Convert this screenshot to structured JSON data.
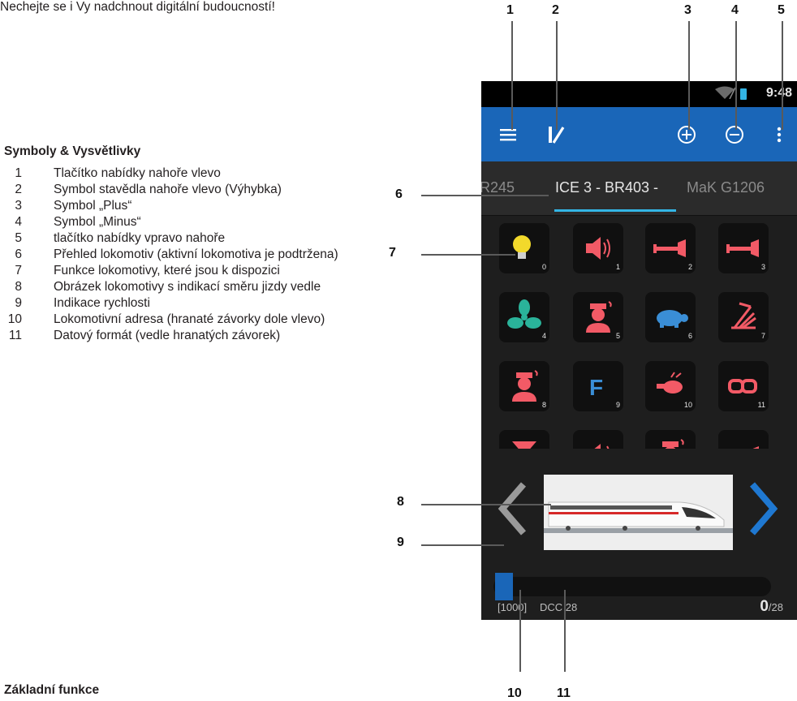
{
  "intro_text": "Nechejte se i Vy nadchnout digitální budoucností!",
  "legend": {
    "heading": "Symboly & Vysvětlivky",
    "items": [
      {
        "num": "1",
        "text": "Tlačítko nabídky nahoře vlevo"
      },
      {
        "num": "2",
        "text": "Symbol stavědla nahoře vlevo (Výhybka)"
      },
      {
        "num": "3",
        "text": "Symbol „Plus“"
      },
      {
        "num": "4",
        "text": "Symbol „Minus“"
      },
      {
        "num": "5",
        "text": "tlačítko nabídky vpravo nahoře"
      },
      {
        "num": "6",
        "text": "Přehled lokomotiv (aktivní lokomotiva je podtržena)"
      },
      {
        "num": "7",
        "text": "Funkce lokomotivy, které jsou k dispozici"
      },
      {
        "num": "8",
        "text": "Obrázek lokomotivy s indikací směru jizdy vedle"
      },
      {
        "num": "9",
        "text": "Indikace rychlosti"
      },
      {
        "num": "10",
        "text": "Lokomotivní adresa (hranaté závorky dole vlevo)"
      },
      {
        "num": "11",
        "text": "Datový formát (vedle hranatých závorek)"
      }
    ]
  },
  "section_heading": "Základní funkce",
  "callouts": [
    "1",
    "2",
    "3",
    "4",
    "5",
    "6",
    "7",
    "8",
    "9",
    "10",
    "11"
  ],
  "phone": {
    "status_time": "9:48",
    "icons": {
      "menu": "menu-icon",
      "switch": "turnout-icon",
      "plus": "plus-circle-icon",
      "minus": "minus-circle-icon",
      "overflow": "overflow-menu-icon"
    },
    "tabs": [
      {
        "label": "R245",
        "active": false
      },
      {
        "label": "ICE 3 - BR403 -",
        "active": true
      },
      {
        "label": "MaK G1206",
        "active": false
      }
    ],
    "functions": [
      {
        "num": "0",
        "icon": "bulb-icon",
        "color": "#f2d92b"
      },
      {
        "num": "1",
        "icon": "speaker-icon",
        "color": "#f25a66"
      },
      {
        "num": "2",
        "icon": "horn-icon",
        "color": "#f25a66"
      },
      {
        "num": "3",
        "icon": "horn-icon",
        "color": "#f25a66"
      },
      {
        "num": "4",
        "icon": "fan-icon",
        "color": "#2ab39a"
      },
      {
        "num": "5",
        "icon": "conductor-icon",
        "color": "#f25a66"
      },
      {
        "num": "6",
        "icon": "turtle-icon",
        "color": "#3a8ed6"
      },
      {
        "num": "7",
        "icon": "pantograph-icon",
        "color": "#f25a66"
      },
      {
        "num": "8",
        "icon": "conductor-icon",
        "color": "#f25a66"
      },
      {
        "num": "9",
        "icon": "f-icon",
        "color": "#3a8ed6",
        "glyph": "F"
      },
      {
        "num": "10",
        "icon": "whistle-icon",
        "color": "#f25a66"
      },
      {
        "num": "11",
        "icon": "coupling-icon",
        "color": "#f25a66"
      },
      {
        "num": "",
        "icon": "horn-vertical-icon",
        "color": "#f25a66"
      },
      {
        "num": "",
        "icon": "speaker-icon",
        "color": "#f25a66"
      },
      {
        "num": "",
        "icon": "conductor-icon",
        "color": "#f25a66"
      },
      {
        "num": "",
        "icon": "horn-icon",
        "color": "#f25a66"
      }
    ],
    "address": "[1000]",
    "format": "DCC 28",
    "speed": "0",
    "speed_max": "/28",
    "colors": {
      "appbar": "#1a66b8",
      "accent": "#33b5e5",
      "arrow_back": "#9a9a9a",
      "arrow_forward": "#1f78d1"
    }
  }
}
